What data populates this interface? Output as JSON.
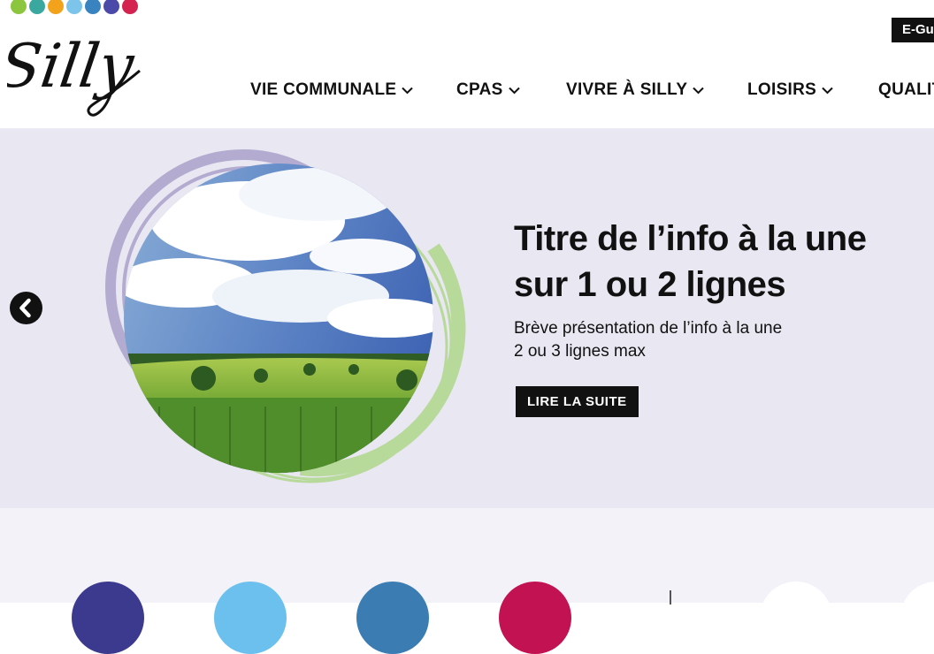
{
  "header": {
    "brand_dots": [
      "#8cc63f",
      "#3aa89f",
      "#f2a31b",
      "#7dc4ea",
      "#3a83c1",
      "#4c4aa8",
      "#d4234f"
    ],
    "logo_text": "Silly",
    "eguichet_label": "E-Guichet",
    "nav": [
      {
        "label": "VIE COMMUNALE",
        "icon": "chevron-down-icon"
      },
      {
        "label": "CPAS",
        "icon": "chevron-down-icon"
      },
      {
        "label": "VIVRE À SILLY",
        "icon": "chevron-down-icon"
      },
      {
        "label": "LOISIRS",
        "icon": "chevron-down-icon"
      },
      {
        "label": "QUALITÉ"
      }
    ]
  },
  "hero": {
    "title": "Titre de l’info à la une sur 1 ou 2 lignes",
    "description_line1": "Brève présentation de l’info à la une",
    "description_line2": "2 ou 3 lignes max",
    "button_label": "LIRE LA SUITE",
    "prev_icon": "chevron-left-icon",
    "colors": {
      "background": "#e9e7f1",
      "ring_purple": "#b3acd0",
      "ring_green": "#b7d99a"
    }
  },
  "quick_links": {
    "colors": [
      "#3b3a8e",
      "#6cc0ee",
      "#3b7db3",
      "#c21252",
      "#ffffff",
      "#ffffff"
    ]
  }
}
